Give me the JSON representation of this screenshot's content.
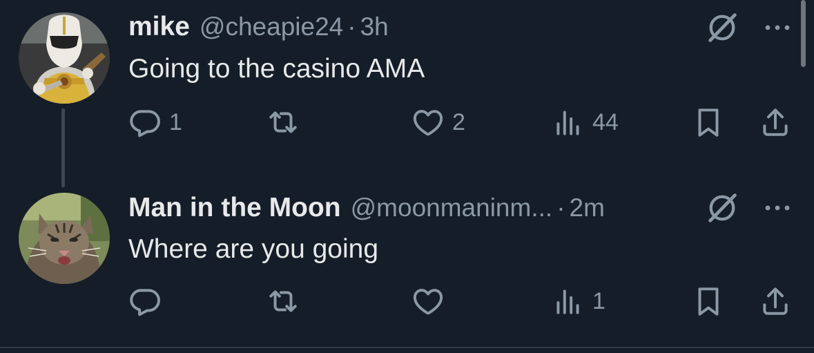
{
  "tweets": [
    {
      "author_name": "mike",
      "author_handle": "@cheapie24",
      "separator": "·",
      "time": "3h",
      "text": "Going to the casino AMA",
      "avatar": "power-ranger-avatar",
      "reply_count": "1",
      "retweet_count": "",
      "like_count": "2",
      "view_count": "44"
    },
    {
      "author_name": "Man in the Moon",
      "author_handle": "@moonmaninm...",
      "separator": "·",
      "time": "2m",
      "text": "Where are you going",
      "avatar": "cat-avatar",
      "reply_count": "",
      "retweet_count": "",
      "like_count": "",
      "view_count": "1"
    }
  ],
  "icons": {
    "reply": "reply-icon",
    "retweet": "retweet-icon",
    "like": "heart-icon",
    "views": "views-icon",
    "bookmark": "bookmark-icon",
    "share": "share-icon",
    "grok": "grok-icon",
    "more": "more-icon"
  },
  "colors": {
    "background": "#151d28",
    "text_primary": "#e7e9ea",
    "text_secondary": "#8b98a5"
  }
}
